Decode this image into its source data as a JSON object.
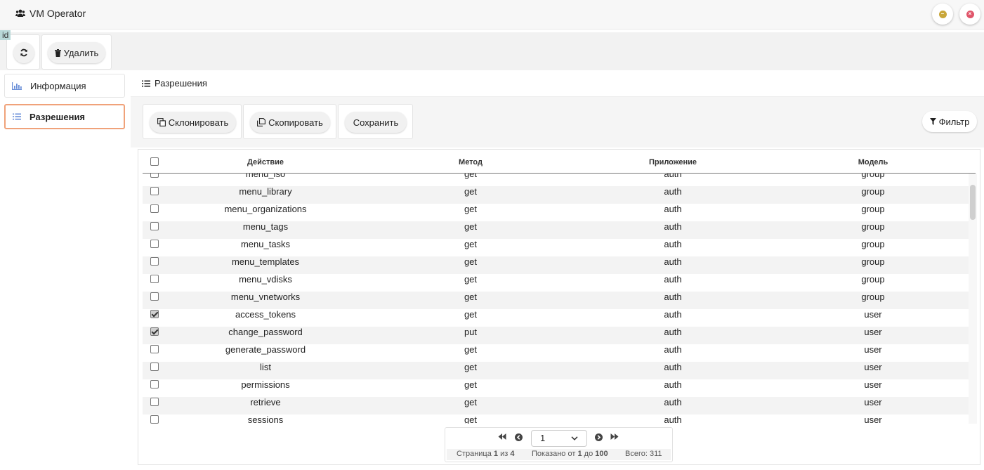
{
  "window": {
    "title": "VM Operator",
    "minimize_icon": "minimize-circle-icon",
    "close_icon": "close-circle-icon",
    "minimize_color": "#c9a73a",
    "close_color": "#e0556a"
  },
  "id_tag": "id",
  "toolbar": {
    "refresh_icon": "refresh-icon",
    "delete_label": "Удалить"
  },
  "sidebar": {
    "items": [
      {
        "label": "Информация",
        "icon": "bar-chart-icon",
        "active": false
      },
      {
        "label": "Разрешения",
        "icon": "list-icon",
        "active": true
      }
    ]
  },
  "section": {
    "title": "Разрешения"
  },
  "actions": {
    "clone_label": "Склонировать",
    "copy_label": "Скопировать",
    "save_label": "Сохранить",
    "filter_label": "Фильтр"
  },
  "table": {
    "columns": [
      "Действие",
      "Метод",
      "Приложение",
      "Модель"
    ],
    "rows": [
      {
        "action": "menu_iso",
        "method": "get",
        "app": "auth",
        "model": "group",
        "checked": false
      },
      {
        "action": "menu_library",
        "method": "get",
        "app": "auth",
        "model": "group",
        "checked": false
      },
      {
        "action": "menu_organizations",
        "method": "get",
        "app": "auth",
        "model": "group",
        "checked": false
      },
      {
        "action": "menu_tags",
        "method": "get",
        "app": "auth",
        "model": "group",
        "checked": false
      },
      {
        "action": "menu_tasks",
        "method": "get",
        "app": "auth",
        "model": "group",
        "checked": false
      },
      {
        "action": "menu_templates",
        "method": "get",
        "app": "auth",
        "model": "group",
        "checked": false
      },
      {
        "action": "menu_vdisks",
        "method": "get",
        "app": "auth",
        "model": "group",
        "checked": false
      },
      {
        "action": "menu_vnetworks",
        "method": "get",
        "app": "auth",
        "model": "group",
        "checked": false
      },
      {
        "action": "access_tokens",
        "method": "get",
        "app": "auth",
        "model": "user",
        "checked": true
      },
      {
        "action": "change_password",
        "method": "put",
        "app": "auth",
        "model": "user",
        "checked": true
      },
      {
        "action": "generate_password",
        "method": "get",
        "app": "auth",
        "model": "user",
        "checked": false
      },
      {
        "action": "list",
        "method": "get",
        "app": "auth",
        "model": "user",
        "checked": false
      },
      {
        "action": "permissions",
        "method": "get",
        "app": "auth",
        "model": "user",
        "checked": false
      },
      {
        "action": "retrieve",
        "method": "get",
        "app": "auth",
        "model": "user",
        "checked": false
      },
      {
        "action": "sessions",
        "method": "get",
        "app": "auth",
        "model": "user",
        "checked": false
      }
    ]
  },
  "pagination": {
    "page_value": "1",
    "page_prefix": "Страница",
    "page_current": "1",
    "page_of": "из",
    "page_total": "4",
    "shown_prefix": "Показано от",
    "shown_from": "1",
    "shown_to_word": "до",
    "shown_to": "100",
    "total_label": "Всего:",
    "total_value": "311"
  }
}
